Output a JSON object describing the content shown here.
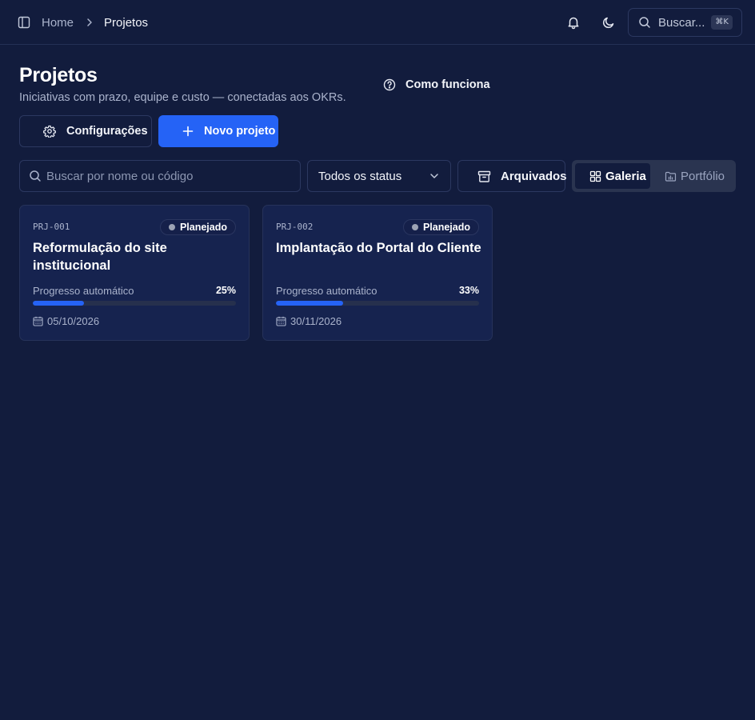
{
  "breadcrumb": {
    "home": "Home",
    "current": "Projetos"
  },
  "topbar": {
    "search_label": "Buscar...",
    "shortcut": "⌘K"
  },
  "header": {
    "title": "Projetos",
    "subtitle": "Iniciativas com prazo, equipe e custo — conectadas aos OKRs.",
    "how_it_works": "Como funciona"
  },
  "actions": {
    "settings_label": "Configurações",
    "new_project_label": "Novo projeto"
  },
  "filters": {
    "search_placeholder": "Buscar por nome ou código",
    "status_selected": "Todos os status",
    "archived_label": "Arquivados",
    "view_gallery": "Galeria",
    "view_portfolio": "Portfólio",
    "active_view": "Galeria"
  },
  "colors": {
    "background": "#121c3d",
    "card": "#16234f",
    "accent": "#2563f6",
    "status_planned": "#9ca3b4"
  },
  "projects": [
    {
      "code": "PRJ-001",
      "status": "Planejado",
      "title": "Reformulação do site institucional",
      "progress_label": "Progresso automático",
      "progress": 25,
      "progress_text": "25%",
      "date": "05/10/2026"
    },
    {
      "code": "PRJ-002",
      "status": "Planejado",
      "title": "Implantação do Portal do Cliente",
      "progress_label": "Progresso automático",
      "progress": 33,
      "progress_text": "33%",
      "date": "30/11/2026"
    }
  ]
}
